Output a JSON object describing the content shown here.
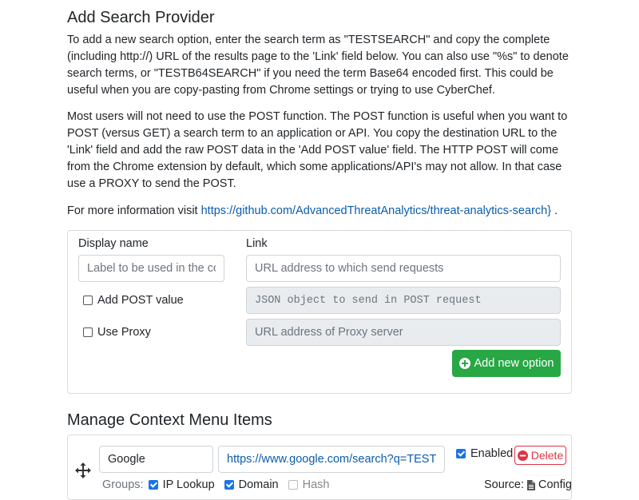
{
  "add_section": {
    "title": "Add Search Provider",
    "para1": "To add a new search option, enter the search term as \"TESTSEARCH\" and copy the complete (including http://) URL of the results page to the 'Link' field below. You can also use \"%s\" to denote search terms, or \"TESTB64SEARCH\" if you need the term Base64 encoded first. This could be useful when you are copy-pasting from Chrome settings or trying to use CyberChef.",
    "para2": "Most users will not need to use the POST function. The POST function is useful when you want to POST (versus GET) a search term to an application or API. You copy the destination URL to the 'Link' field and add the raw POST data in the 'Add POST value' field. The HTTP POST will come from the Chrome extension by default, which some applications/API's may not allow. In that case use a PROXY to send the POST.",
    "more_info_prefix": "For more information visit",
    "more_info_link": "https://github.com/AdvancedThreatAnalytics/threat-analytics-search}",
    "more_info_suffix": "."
  },
  "form": {
    "display_name_label": "Display name",
    "display_name_placeholder": "Label to be used in the context menu",
    "link_label": "Link",
    "link_placeholder": "URL address to which send requests",
    "post_checkbox_label": "Add POST value",
    "post_placeholder": "JSON object to send in POST request",
    "proxy_checkbox_label": "Use Proxy",
    "proxy_placeholder": "URL address of Proxy server",
    "add_button_label": "Add new option"
  },
  "manage_section": {
    "title": "Manage Context Menu Items",
    "items": [
      {
        "name": "Google",
        "url": "https://www.google.com/search?q=TESTSEARCH",
        "enabled_label": "Enabled",
        "enabled": true,
        "delete_label": "Delete",
        "groups_label": "Groups:",
        "groups": [
          {
            "label": "IP Lookup",
            "checked": true
          },
          {
            "label": "Domain",
            "checked": true
          },
          {
            "label": "Hash",
            "checked": false
          }
        ],
        "source_label": "Source:",
        "source_value": "Config"
      }
    ]
  },
  "colors": {
    "primary": "#28a745",
    "danger": "#dc3545",
    "link": "#0b5cad",
    "checkbox": "#1a73e8"
  }
}
